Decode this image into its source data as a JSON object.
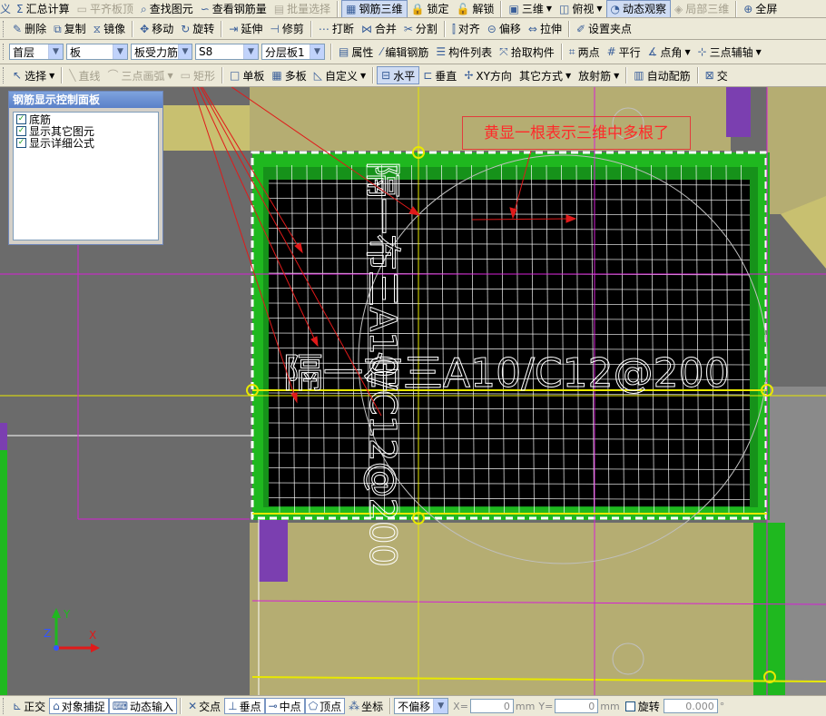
{
  "toolbar_main": {
    "items": [
      {
        "label": "汇总计算",
        "icon": "sigma-icon",
        "disabled": false
      },
      {
        "label": "平齐板顶",
        "icon": "align-top-icon",
        "disabled": true
      },
      {
        "label": "查找图元",
        "icon": "find-icon",
        "disabled": false
      },
      {
        "label": "查看钢筋量",
        "icon": "view-rebar-icon",
        "disabled": false
      },
      {
        "label": "批量选择",
        "icon": "batch-select-icon",
        "disabled": true
      },
      {
        "label": "钢筋三维",
        "icon": "rebar-3d-icon",
        "disabled": false,
        "pressed": true
      },
      {
        "label": "锁定",
        "icon": "lock-icon",
        "disabled": false
      },
      {
        "label": "解锁",
        "icon": "unlock-icon",
        "disabled": false
      },
      {
        "label": "三维",
        "icon": "3d-icon",
        "disabled": false,
        "dropdown": true
      },
      {
        "label": "俯视",
        "icon": "top-view-icon",
        "disabled": false,
        "dropdown": true
      },
      {
        "label": "动态观察",
        "icon": "orbit-icon",
        "disabled": false,
        "pressed": true
      },
      {
        "label": "局部三维",
        "icon": "local-3d-icon",
        "disabled": true
      },
      {
        "label": "全屏",
        "icon": "fullscreen-icon",
        "disabled": false
      }
    ]
  },
  "toolbar_edit": {
    "items": [
      {
        "label": "删除",
        "icon": "delete-icon"
      },
      {
        "label": "复制",
        "icon": "copy-icon"
      },
      {
        "label": "镜像",
        "icon": "mirror-icon"
      },
      {
        "label": "移动",
        "icon": "move-icon"
      },
      {
        "label": "旋转",
        "icon": "rotate-icon"
      },
      {
        "label": "延伸",
        "icon": "extend-icon"
      },
      {
        "label": "修剪",
        "icon": "trim-icon"
      },
      {
        "label": "打断",
        "icon": "break-icon"
      },
      {
        "label": "合并",
        "icon": "merge-icon"
      },
      {
        "label": "分割",
        "icon": "split-icon"
      },
      {
        "label": "对齐",
        "icon": "align-icon"
      },
      {
        "label": "偏移",
        "icon": "offset-icon"
      },
      {
        "label": "拉伸",
        "icon": "stretch-icon"
      },
      {
        "label": "设置夹点",
        "icon": "grip-point-icon"
      }
    ]
  },
  "toolbar_property": {
    "floor": "首层",
    "component": "板",
    "rebar_type": "板受力筋",
    "rebar_name": "S8",
    "layer": "分层板1",
    "items": [
      {
        "label": "属性",
        "icon": "property-icon"
      },
      {
        "label": "编辑钢筋",
        "icon": "edit-rebar-icon"
      },
      {
        "label": "构件列表",
        "icon": "component-list-icon"
      },
      {
        "label": "拾取构件",
        "icon": "pick-component-icon"
      },
      {
        "label": "两点",
        "icon": "two-point-icon"
      },
      {
        "label": "平行",
        "icon": "parallel-icon"
      },
      {
        "label": "点角",
        "icon": "point-angle-icon",
        "dropdown": true
      },
      {
        "label": "三点辅轴",
        "icon": "three-point-axis-icon",
        "dropdown": true
      }
    ]
  },
  "toolbar_draw": {
    "items": [
      {
        "label": "选择",
        "icon": "select-icon",
        "dropdown": true,
        "disabled": false
      },
      {
        "label": "直线",
        "icon": "line-icon",
        "disabled": true
      },
      {
        "label": "三点画弧",
        "icon": "arc-icon",
        "disabled": true,
        "dropdown": true
      },
      {
        "label": "矩形",
        "icon": "rectangle-icon",
        "disabled": true
      },
      {
        "label": "单板",
        "icon": "single-slab-icon",
        "disabled": false
      },
      {
        "label": "多板",
        "icon": "multi-slab-icon",
        "disabled": false
      },
      {
        "label": "自定义",
        "icon": "custom-icon",
        "disabled": false,
        "dropdown": true
      },
      {
        "label": "水平",
        "icon": "horizontal-icon",
        "disabled": false,
        "pressed": true
      },
      {
        "label": "垂直",
        "icon": "vertical-icon",
        "disabled": false
      },
      {
        "label": "XY方向",
        "icon": "xy-direction-icon",
        "disabled": false
      },
      {
        "label": "其它方式",
        "icon": "",
        "disabled": false,
        "dropdown": true
      },
      {
        "label": "放射筋",
        "icon": "",
        "disabled": false,
        "dropdown": true
      },
      {
        "label": "自动配筋",
        "icon": "auto-rebar-icon",
        "disabled": false
      },
      {
        "label": "交",
        "icon": "intersect-icon",
        "disabled": false
      }
    ]
  },
  "panel": {
    "title": "钢筋显示控制面板",
    "options": [
      {
        "label": "底筋",
        "checked": true
      },
      {
        "label": "显示其它图元",
        "checked": true
      },
      {
        "label": "显示详细公式",
        "checked": true
      }
    ]
  },
  "canvas": {
    "annotation": "黄显一根表示三维中多根了",
    "rebar_label_horizontal": "隔一布三A10/C12@200",
    "rebar_label_vertical": "隔一布三A10/C12@200",
    "axis_x": "X",
    "axis_y": "Y",
    "axis_z": "Z",
    "colors": {
      "background": "#6b6b6b",
      "slab_fill": "#b5ad72",
      "slab_dark": "#000000",
      "border_green": "#1fb81f",
      "rebar_white": "#ffffff",
      "magenta": "#d61fd6",
      "yellow": "#e8e800",
      "red_arrow": "#e01a1a",
      "purple": "#7b3fb0"
    }
  },
  "status_bar": {
    "items": [
      {
        "label": "正交",
        "icon": "ortho-icon",
        "on": false
      },
      {
        "label": "对象捕捉",
        "icon": "object-snap-icon",
        "on": true
      },
      {
        "label": "动态输入",
        "icon": "dynamic-input-icon",
        "on": true
      },
      {
        "label": "交点",
        "icon": "intersection-snap-icon",
        "on": false
      },
      {
        "label": "垂点",
        "icon": "perpendicular-snap-icon",
        "on": true
      },
      {
        "label": "中点",
        "icon": "midpoint-snap-icon",
        "on": true
      },
      {
        "label": "顶点",
        "icon": "vertex-snap-icon",
        "on": true
      },
      {
        "label": "坐标",
        "icon": "coordinate-snap-icon",
        "on": false
      }
    ],
    "offset_mode": "不偏移",
    "x_label": "X=",
    "x_value": "0",
    "y_label": "Y=",
    "y_value": "0",
    "unit": "mm",
    "rotate_label": "旋转",
    "rotate_value": "0.000",
    "degree": "°"
  }
}
